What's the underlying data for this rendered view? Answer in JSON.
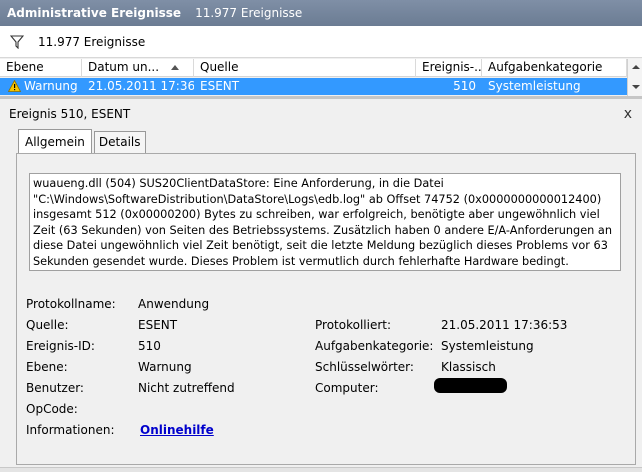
{
  "title": {
    "name": "Administrative Ereignisse",
    "count": "11.977 Ereignisse"
  },
  "toolbar": {
    "filter_label": "11.977 Ereignisse"
  },
  "grid": {
    "columns": [
      "Ebene",
      "Datum un...",
      "Quelle",
      "Ereignis-...",
      "Aufgabenkategorie"
    ],
    "row": {
      "level": "Warnung",
      "date": "21.05.2011 17:36:53",
      "source": "ESENT",
      "event_id": "510",
      "category": "Systemleistung"
    }
  },
  "detail": {
    "heading": "Ereignis 510, ESENT",
    "close": "x",
    "tabs": [
      "Allgemein",
      "Details"
    ],
    "message": "wuaueng.dll (504) SUS20ClientDataStore: Eine Anforderung, in die Datei \"C:\\Windows\\SoftwareDistribution\\DataStore\\Logs\\edb.log\" ab Offset 74752 (0x0000000000012400) insgesamt 512 (0x00000200) Bytes zu schreiben, war erfolgreich, benötigte aber ungewöhnlich viel Zeit (63 Sekunden) von Seiten des Betriebssystems. Zusätzlich haben 0 andere E/A-Anforderungen an diese Datei ungewöhnlich viel Zeit benötigt, seit die letzte Meldung bezüglich dieses Problems vor 63 Sekunden gesendet wurde. Dieses Problem ist vermutlich durch fehlerhafte Hardware bedingt. Wenden Sie sich für weitere Unterstützung bei der Diagnose des Problems an Ihren Hardwarehersteller.",
    "props": {
      "protokollname_label": "Protokollname:",
      "protokollname_value": "Anwendung",
      "quelle_label": "Quelle:",
      "quelle_value": "ESENT",
      "protokolliert_label": "Protokolliert:",
      "protokolliert_value": "21.05.2011 17:36:53",
      "ereignis_id_label": "Ereignis-ID:",
      "ereignis_id_value": "510",
      "aufgabenkategorie_label": "Aufgabenkategorie:",
      "aufgabenkategorie_value": "Systemleistung",
      "ebene_label": "Ebene:",
      "ebene_value": "Warnung",
      "schluesselwoerter_label": "Schlüsselwörter:",
      "schluesselwoerter_value": "Klassisch",
      "benutzer_label": "Benutzer:",
      "benutzer_value": "Nicht zutreffend",
      "computer_label": "Computer:",
      "opcode_label": "OpCode:",
      "informationen_label": "Informationen:",
      "informationen_link": "Onlinehilfe"
    }
  },
  "colors": {
    "title_bg": "#6b7c93",
    "selection": "#3399ff",
    "link": "#0000cc",
    "warning": "#f5c400"
  }
}
